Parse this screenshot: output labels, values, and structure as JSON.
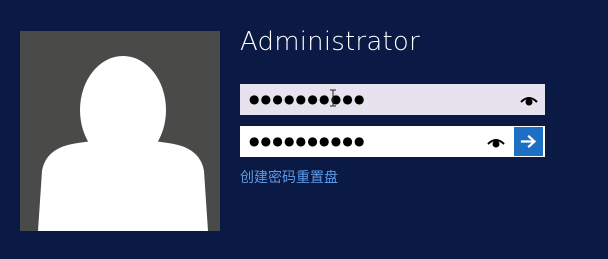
{
  "user": {
    "name": "Administrator"
  },
  "password_field": {
    "value": "●●●●●●●●●●",
    "reveal_icon": "eye-icon"
  },
  "confirm_field": {
    "value": "●●●●●●●●●●",
    "reveal_icon": "eye-icon",
    "submit_icon": "arrow-right-icon"
  },
  "reset_link": {
    "label": "创建密码重置盘"
  },
  "colors": {
    "background": "#0b1a45",
    "avatar_bg": "#4a4a48",
    "submit_bg": "#1c6fc2",
    "link": "#5c9ae6"
  }
}
